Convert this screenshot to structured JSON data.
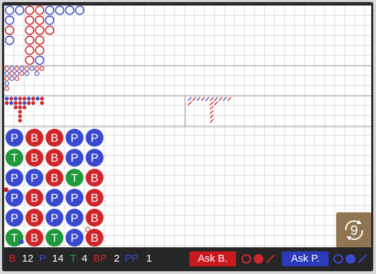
{
  "colors": {
    "banker": "#d0262a",
    "player": "#3a4ad0",
    "tie": "#1f9a3b",
    "grid": "#dcdcdc",
    "divider": "#9a9a9a",
    "switch_bg": "#8f7551"
  },
  "bead_road": [
    [
      "P",
      "T",
      "P",
      "P",
      "P",
      "T"
    ],
    [
      "B",
      "B",
      "P",
      "B",
      "B",
      "B"
    ],
    [
      "B",
      "B",
      "B",
      "P",
      "P",
      "T"
    ],
    [
      "P",
      "P",
      "T",
      "P",
      "P",
      "P"
    ],
    [
      "P",
      "P",
      "B",
      "B",
      "B",
      "B"
    ]
  ],
  "big_road": [
    [
      "P",
      "P",
      "B",
      "P"
    ],
    [
      "P"
    ],
    [
      "B",
      "B",
      "B",
      "B",
      "B",
      "B"
    ],
    [
      "B",
      "B",
      "B",
      "B",
      "B",
      "P"
    ],
    [
      "P",
      "P",
      "B"
    ],
    [
      "P"
    ],
    [
      "P"
    ],
    [
      "P"
    ]
  ],
  "stats": {
    "banker_label": "B",
    "banker": "12",
    "player_label": "P",
    "player": "14",
    "tie_label": "T",
    "tie": "4",
    "bp_label": "BP",
    "bp": "2",
    "pp_label": "PP",
    "pp": "1"
  },
  "actions": {
    "ask_banker": "Ask B.",
    "ask_player": "Ask P."
  },
  "switch_icon": "rotate-icon",
  "switch_value": "9"
}
